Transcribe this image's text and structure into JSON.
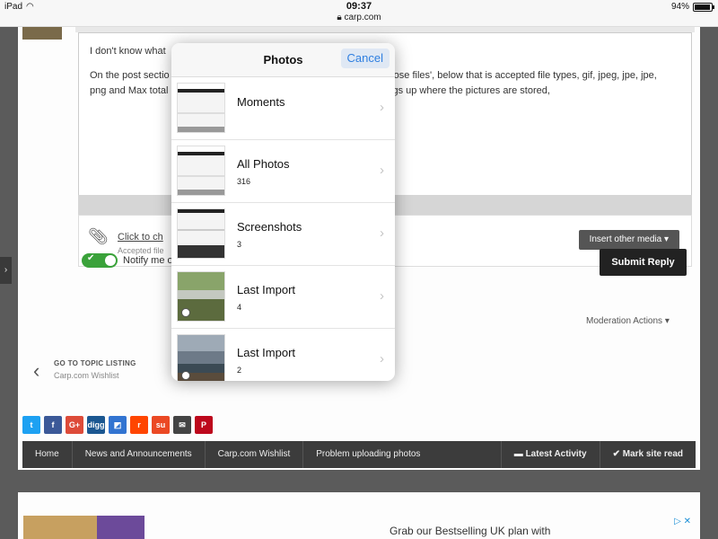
{
  "status_bar": {
    "device": "iPad",
    "time": "09:37",
    "url": "carp.com",
    "battery": "94%",
    "battery_level": 0.94
  },
  "editor": {
    "line1": "I don't know what",
    "line2_a": "On the post sectio",
    "line2_b": "ose files', below that is accepted file types, gif, jpeg, jpe, jpe,",
    "line3_a": "png and Max total",
    "line3_b": "gs up where the pictures are stored,"
  },
  "attachments": {
    "link": "Click to ch",
    "accepted": "Accepted file",
    "insert_media": "Insert other media ▾"
  },
  "notify": {
    "label": "Notify me o",
    "checked": true
  },
  "submit_label": "Submit Reply",
  "moderation_actions": "Moderation Actions ▾",
  "go_to_topic": {
    "label": "GO TO TOPIC LISTING",
    "sub": "Carp.com Wishlist"
  },
  "share": [
    {
      "name": "twitter-share-button",
      "glyph": "t",
      "color": "#1da1f2"
    },
    {
      "name": "facebook-share-button",
      "glyph": "f",
      "color": "#3b5998"
    },
    {
      "name": "google-plus-share-button",
      "glyph": "G+",
      "color": "#dd4b39"
    },
    {
      "name": "digg-share-button",
      "glyph": "digg",
      "color": "#1b5791"
    },
    {
      "name": "delicious-share-button",
      "glyph": "◩",
      "color": "#3274d1"
    },
    {
      "name": "reddit-share-button",
      "glyph": "r",
      "color": "#ff4500"
    },
    {
      "name": "stumbleupon-share-button",
      "glyph": "su",
      "color": "#eb4924"
    },
    {
      "name": "email-share-button",
      "glyph": "✉",
      "color": "#444"
    },
    {
      "name": "pinterest-share-button",
      "glyph": "P",
      "color": "#bd081c"
    }
  ],
  "breadcrumb": {
    "items": [
      "Home",
      "News and Announcements",
      "Carp.com Wishlist",
      "Problem uploading photos"
    ],
    "latest_activity": "Latest Activity",
    "mark_read": "Mark site read"
  },
  "ad": {
    "text": "Grab our Bestselling UK plan with"
  },
  "photos_popover": {
    "title": "Photos",
    "cancel": "Cancel",
    "albums": [
      {
        "name": "Moments",
        "count": ""
      },
      {
        "name": "All Photos",
        "count": "316"
      },
      {
        "name": "Screenshots",
        "count": "3"
      },
      {
        "name": "Last Import",
        "count": "4"
      },
      {
        "name": "Last Import",
        "count": "2"
      }
    ]
  }
}
